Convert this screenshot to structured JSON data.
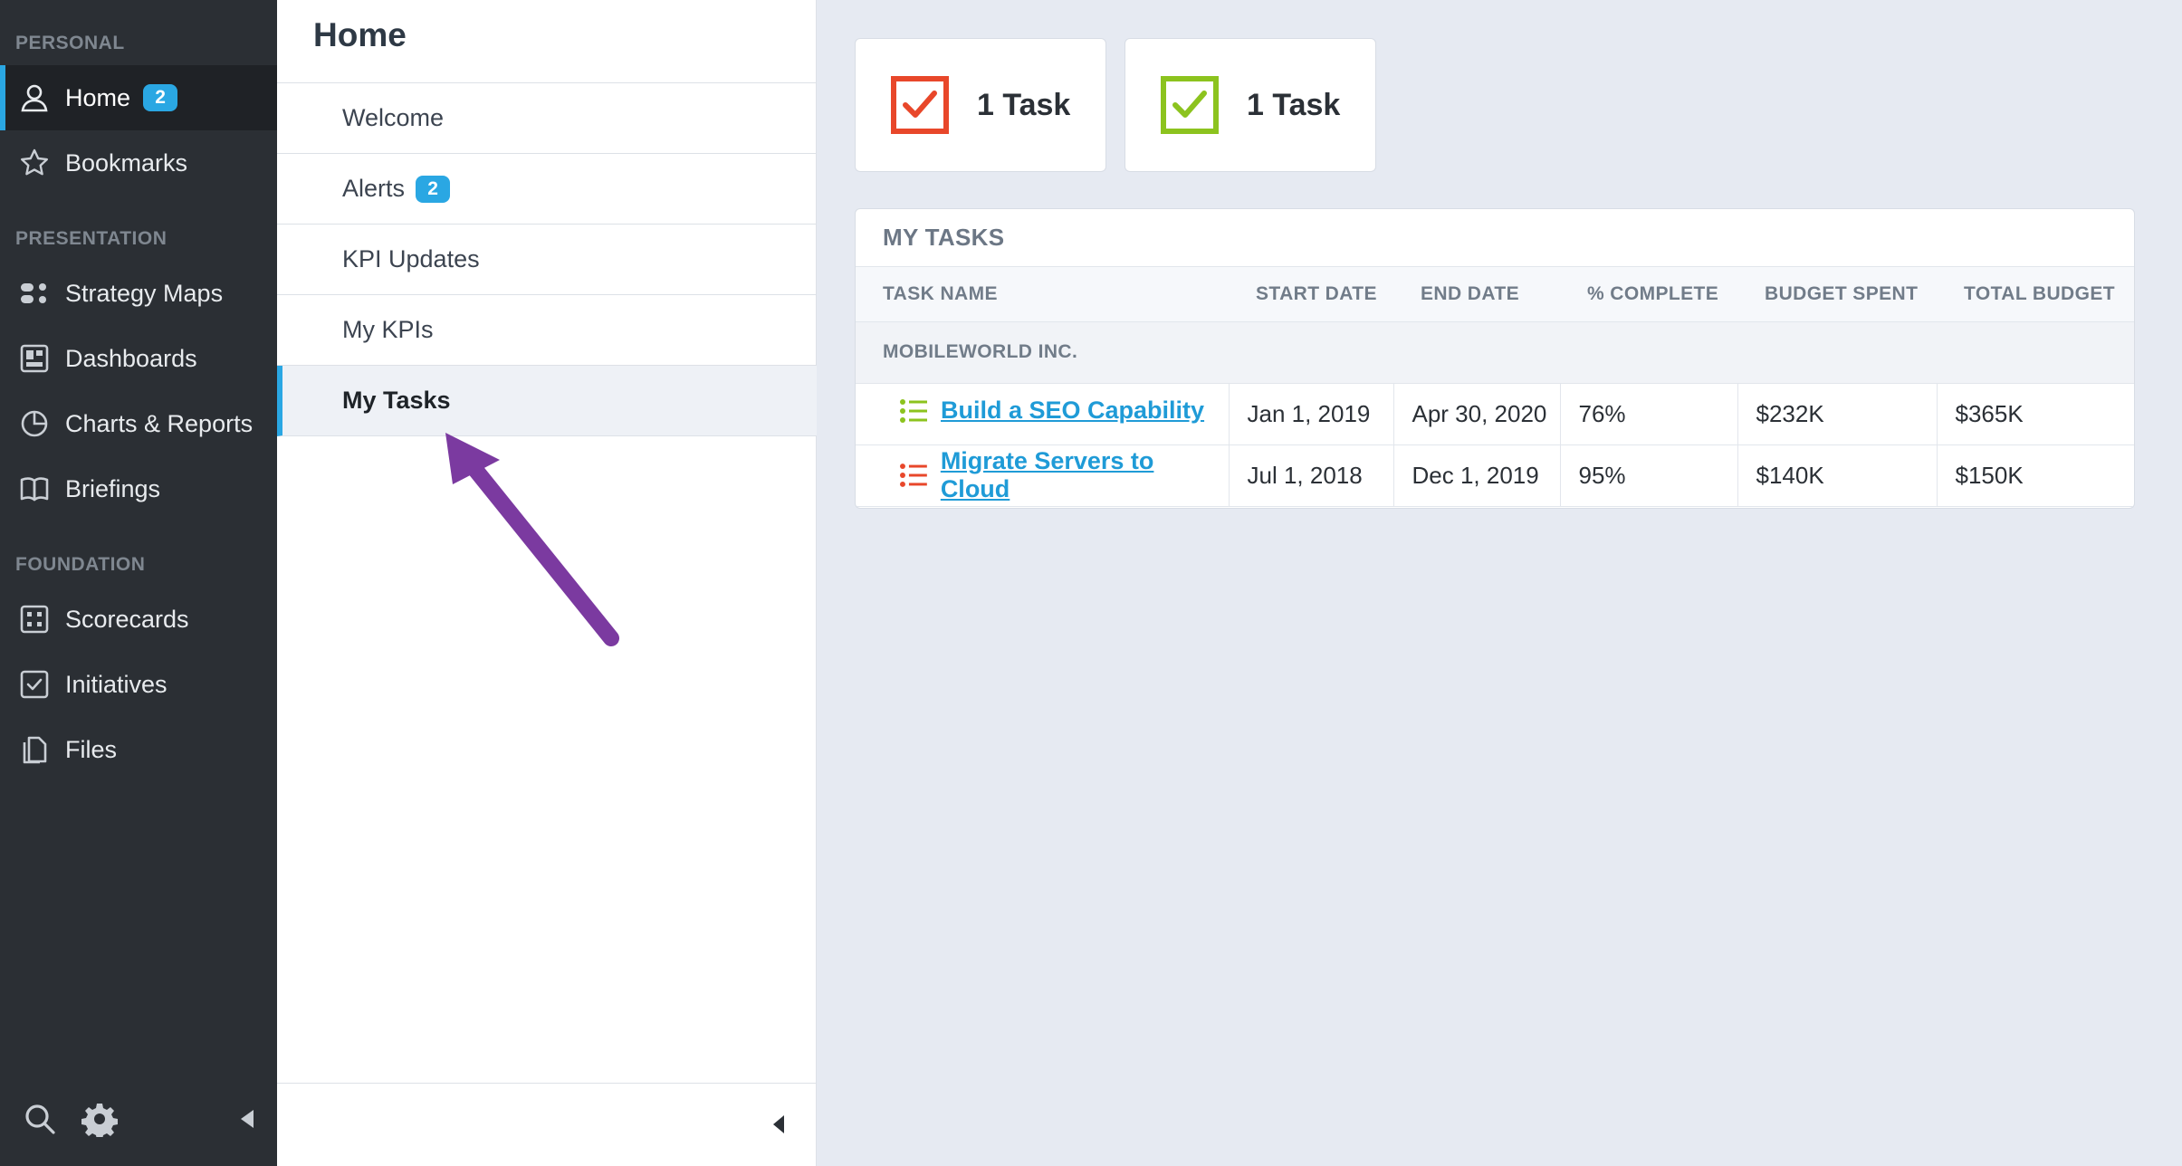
{
  "sidebar": {
    "sections": {
      "personal": "PERSONAL",
      "presentation": "PRESENTATION",
      "foundation": "FOUNDATION"
    },
    "items": {
      "home": {
        "label": "Home",
        "badge": "2",
        "icon": "user-icon"
      },
      "bookmarks": {
        "label": "Bookmarks",
        "icon": "star-icon"
      },
      "strategy_maps": {
        "label": "Strategy Maps",
        "icon": "strategy-map-icon"
      },
      "dashboards": {
        "label": "Dashboards",
        "icon": "dashboard-icon"
      },
      "charts_reports": {
        "label": "Charts & Reports",
        "icon": "pie-chart-icon"
      },
      "briefings": {
        "label": "Briefings",
        "icon": "book-icon"
      },
      "scorecards": {
        "label": "Scorecards",
        "icon": "scorecard-icon"
      },
      "initiatives": {
        "label": "Initiatives",
        "icon": "checkbox-icon"
      },
      "files": {
        "label": "Files",
        "icon": "files-icon"
      }
    },
    "footer": {
      "search": "search-icon",
      "settings": "gear-icon",
      "collapse": "collapse-left-icon"
    }
  },
  "subpanel": {
    "title": "Home",
    "items": {
      "welcome": {
        "label": "Welcome"
      },
      "alerts": {
        "label": "Alerts",
        "badge": "2"
      },
      "kpi_updates": {
        "label": "KPI Updates"
      },
      "my_kpis": {
        "label": "My KPIs"
      },
      "my_tasks": {
        "label": "My Tasks"
      }
    }
  },
  "stats": [
    {
      "label": "1 Task",
      "color": "#e8472a"
    },
    {
      "label": "1 Task",
      "color": "#8cc31e"
    }
  ],
  "tasks": {
    "title": "MY TASKS",
    "columns": {
      "name": "TASK NAME",
      "start": "START DATE",
      "end": "END DATE",
      "complete": "% COMPLETE",
      "spent": "BUDGET SPENT",
      "total": "TOTAL BUDGET"
    },
    "group": "MOBILEWORLD INC.",
    "rows": [
      {
        "name": "Build a SEO Capability",
        "start": "Jan 1, 2019",
        "end": "Apr 30, 2020",
        "complete": "76%",
        "spent": "$232K",
        "total": "$365K",
        "status_color": "#8cc31e"
      },
      {
        "name": "Migrate Servers to Cloud",
        "start": "Jul 1, 2018",
        "end": "Dec 1, 2019",
        "complete": "95%",
        "spent": "$140K",
        "total": "$150K",
        "status_color": "#e8472a"
      }
    ]
  },
  "colors": {
    "accent": "#2aa7e3",
    "sidebar_bg": "#2b2f34",
    "arrow": "#7b3aa0"
  }
}
